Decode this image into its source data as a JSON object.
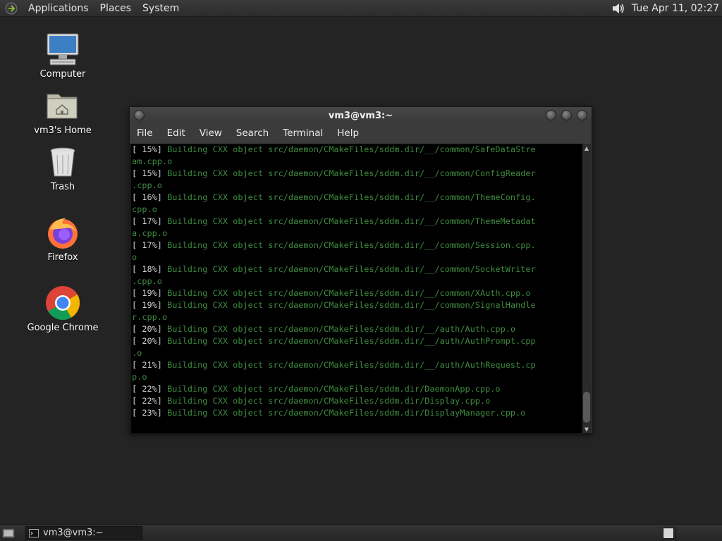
{
  "top_panel": {
    "menus": [
      "Applications",
      "Places",
      "System"
    ],
    "clock": "Tue Apr 11, 02:27"
  },
  "desktop": {
    "icons": [
      {
        "label": "Computer",
        "icon": "computer-icon"
      },
      {
        "label": "vm3's Home",
        "icon": "home-folder-icon"
      },
      {
        "label": "Trash",
        "icon": "trash-icon"
      },
      {
        "label": "Firefox",
        "icon": "firefox-icon"
      },
      {
        "label": "Google Chrome",
        "icon": "chrome-icon"
      }
    ]
  },
  "terminal": {
    "title": "vm3@vm3:~",
    "menu": [
      "File",
      "Edit",
      "View",
      "Search",
      "Terminal",
      "Help"
    ],
    "lines": [
      {
        "pct": "[ 15%]",
        "text": " Building CXX object src/daemon/CMakeFiles/sddm.dir/__/common/SafeDataStre"
      },
      {
        "pct": "",
        "text": "am.cpp.o"
      },
      {
        "pct": "[ 15%]",
        "text": " Building CXX object src/daemon/CMakeFiles/sddm.dir/__/common/ConfigReader"
      },
      {
        "pct": "",
        "text": ".cpp.o"
      },
      {
        "pct": "[ 16%]",
        "text": " Building CXX object src/daemon/CMakeFiles/sddm.dir/__/common/ThemeConfig."
      },
      {
        "pct": "",
        "text": "cpp.o"
      },
      {
        "pct": "[ 17%]",
        "text": " Building CXX object src/daemon/CMakeFiles/sddm.dir/__/common/ThemeMetadat"
      },
      {
        "pct": "",
        "text": "a.cpp.o"
      },
      {
        "pct": "[ 17%]",
        "text": " Building CXX object src/daemon/CMakeFiles/sddm.dir/__/common/Session.cpp."
      },
      {
        "pct": "",
        "text": "o"
      },
      {
        "pct": "[ 18%]",
        "text": " Building CXX object src/daemon/CMakeFiles/sddm.dir/__/common/SocketWriter"
      },
      {
        "pct": "",
        "text": ".cpp.o"
      },
      {
        "pct": "[ 19%]",
        "text": " Building CXX object src/daemon/CMakeFiles/sddm.dir/__/common/XAuth.cpp.o"
      },
      {
        "pct": "[ 19%]",
        "text": " Building CXX object src/daemon/CMakeFiles/sddm.dir/__/common/SignalHandle"
      },
      {
        "pct": "",
        "text": "r.cpp.o"
      },
      {
        "pct": "[ 20%]",
        "text": " Building CXX object src/daemon/CMakeFiles/sddm.dir/__/auth/Auth.cpp.o"
      },
      {
        "pct": "[ 20%]",
        "text": " Building CXX object src/daemon/CMakeFiles/sddm.dir/__/auth/AuthPrompt.cpp"
      },
      {
        "pct": "",
        "text": ".o"
      },
      {
        "pct": "[ 21%]",
        "text": " Building CXX object src/daemon/CMakeFiles/sddm.dir/__/auth/AuthRequest.cp"
      },
      {
        "pct": "",
        "text": "p.o"
      },
      {
        "pct": "[ 22%]",
        "text": " Building CXX object src/daemon/CMakeFiles/sddm.dir/DaemonApp.cpp.o"
      },
      {
        "pct": "[ 22%]",
        "text": " Building CXX object src/daemon/CMakeFiles/sddm.dir/Display.cpp.o"
      },
      {
        "pct": "[ 23%]",
        "text": " Building CXX object src/daemon/CMakeFiles/sddm.dir/DisplayManager.cpp.o"
      }
    ]
  },
  "taskbar": {
    "window_label": "vm3@vm3:~"
  }
}
